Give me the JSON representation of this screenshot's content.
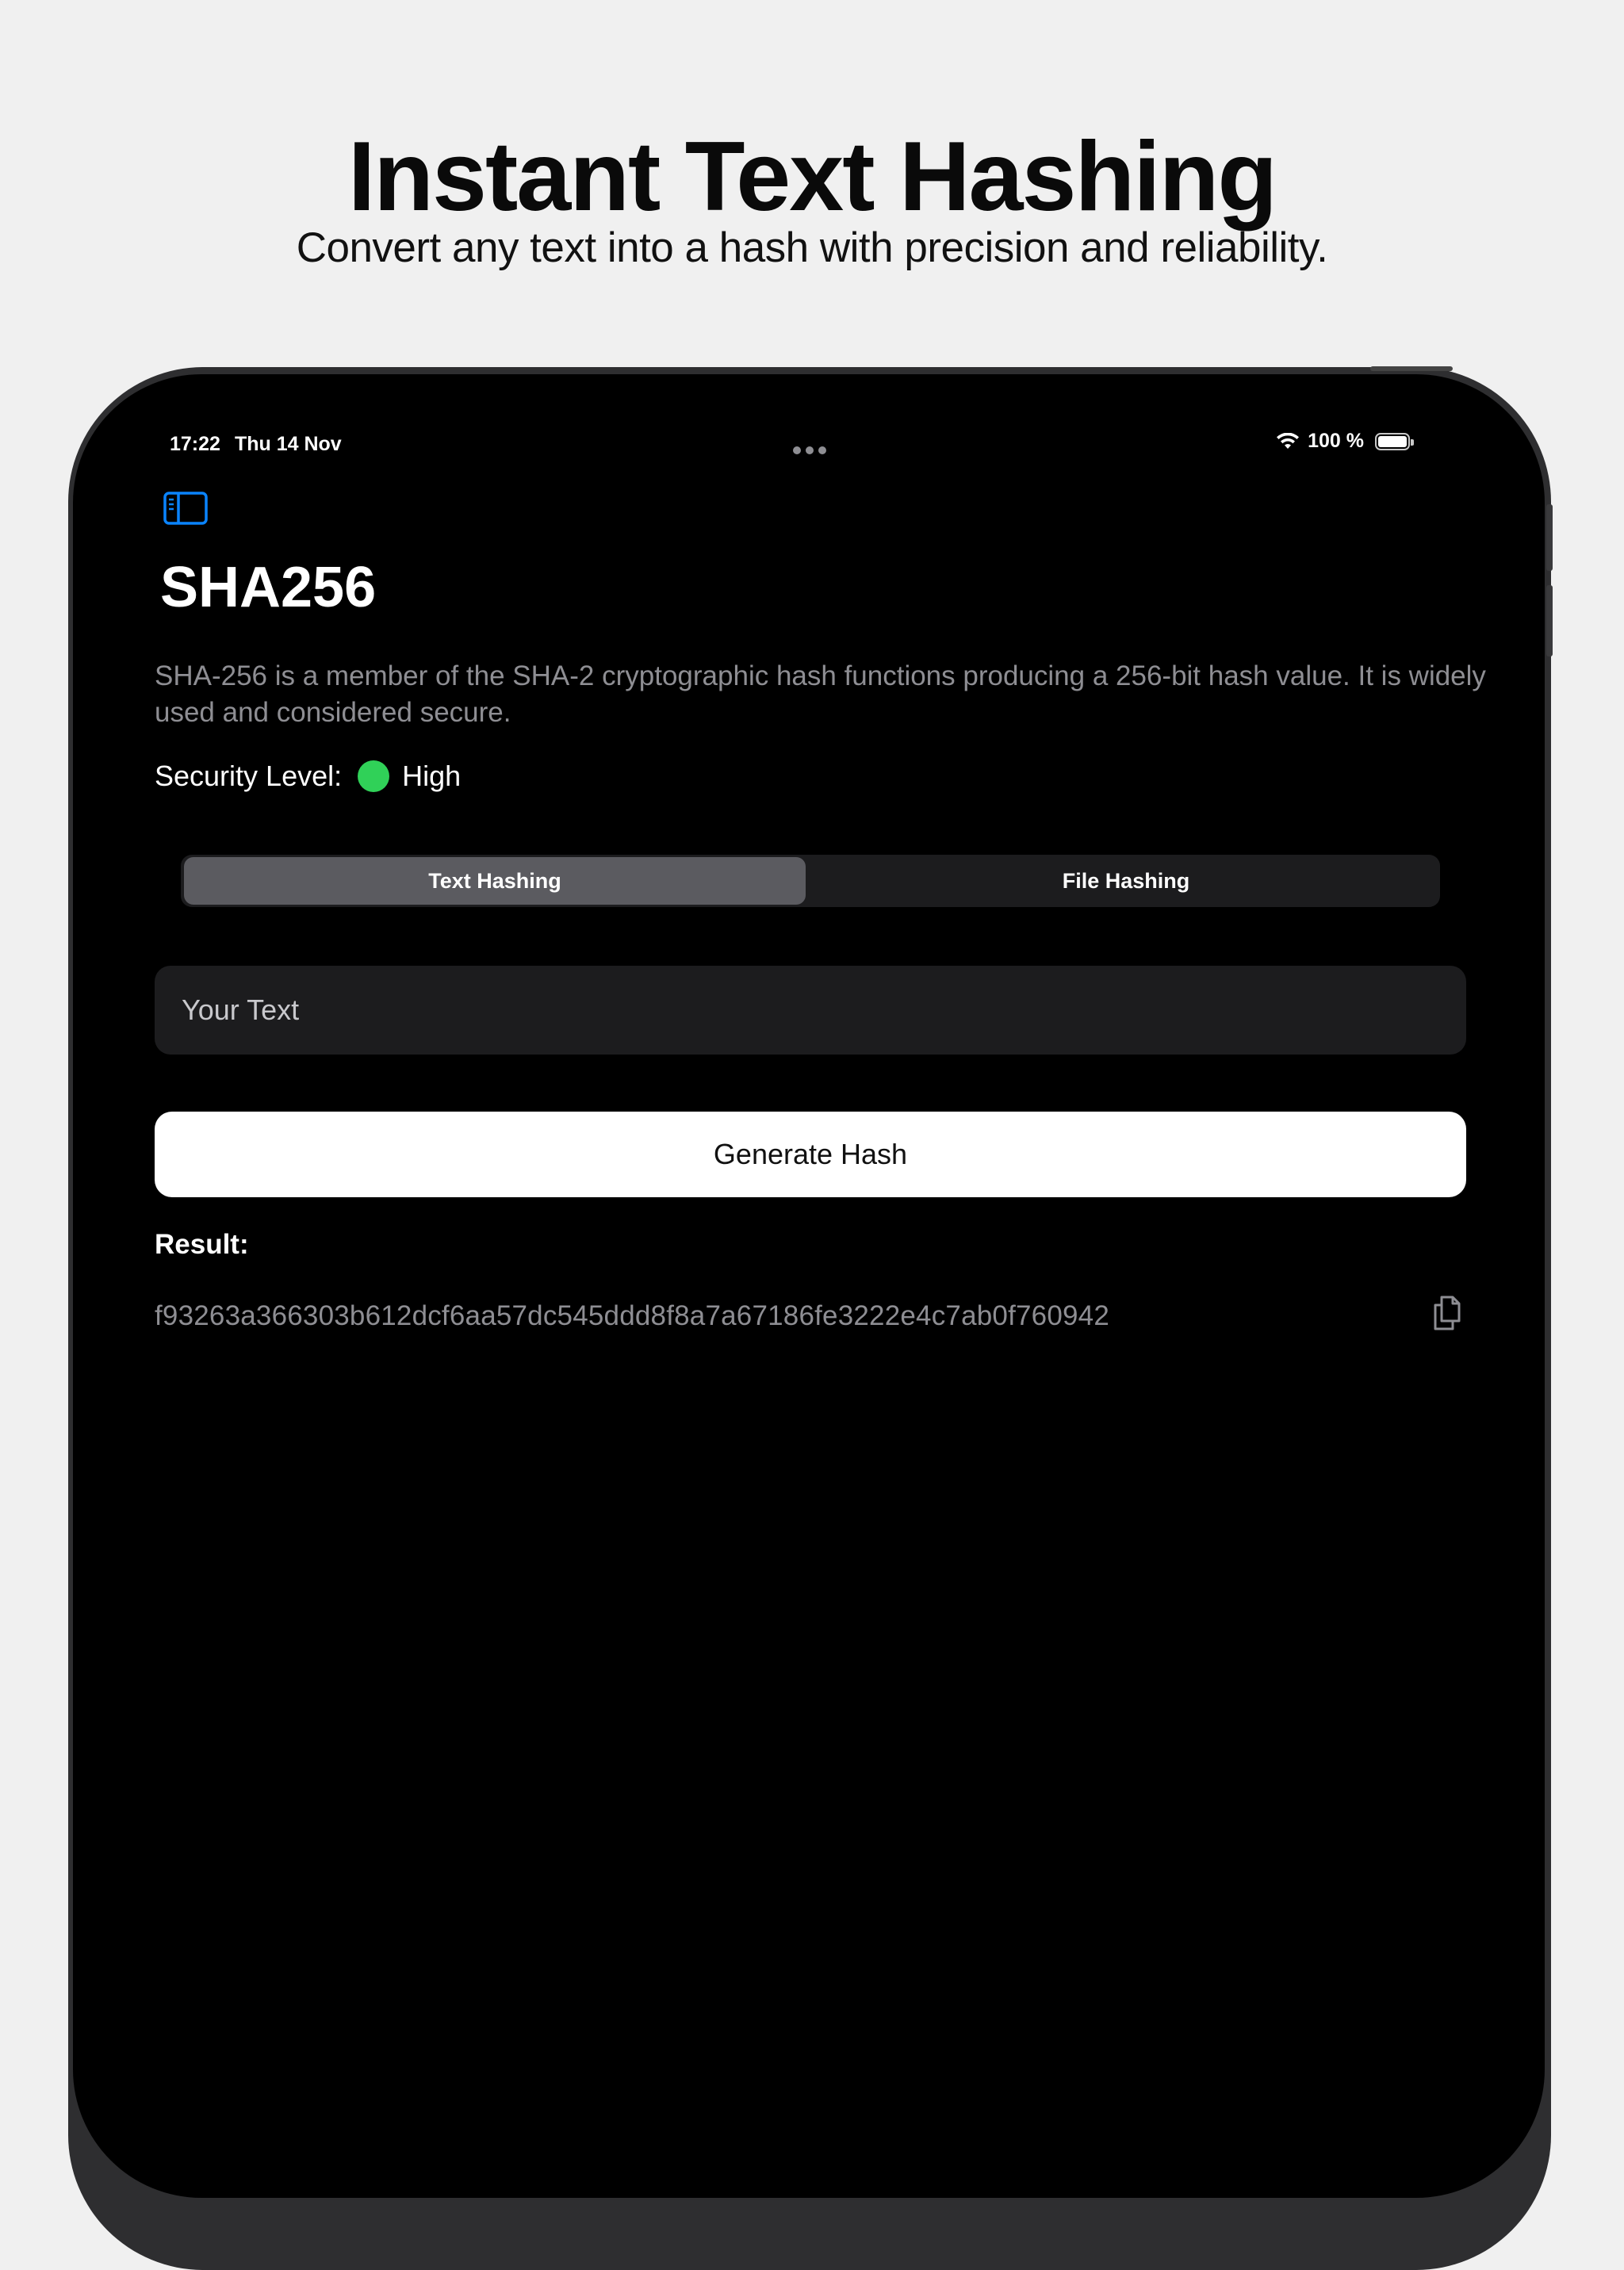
{
  "promo": {
    "headline": "Instant Text Hashing",
    "subline": "Convert any text into a hash with precision and reliability."
  },
  "status_bar": {
    "time": "17:22",
    "date": "Thu 14 Nov",
    "battery": "100 %",
    "battery_level": 1.0
  },
  "header": {
    "sidebar_icon": "sidebar-toggle-icon",
    "title": "SHA256"
  },
  "algorithm": {
    "description": "SHA-256 is a member of the SHA-2 cryptographic hash functions producing a 256-bit hash value. It is widely used and considered secure.",
    "security_label": "Security Level:",
    "security_value": "High",
    "security_color": "#30d158"
  },
  "mode_picker": {
    "options": [
      "Text Hashing",
      "File Hashing"
    ],
    "selected": "Text Hashing"
  },
  "input": {
    "placeholder": "Your Text"
  },
  "actions": {
    "generate_label": "Generate Hash"
  },
  "result": {
    "label": "Result:",
    "value": "f93263a366303b612dcf6aa57dc545ddd8f8a7a67186fe3222e4c7ab0f760942",
    "copy_icon": "copy-icon"
  },
  "colors": {
    "accent": "#0a84ff",
    "background": "#000000",
    "secondary_text": "#8e8e93"
  }
}
